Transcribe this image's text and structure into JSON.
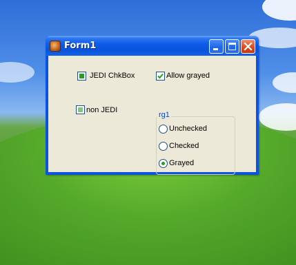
{
  "window": {
    "title": "Form1"
  },
  "controls": {
    "jedi_chkbox_label": "JEDI ChkBox",
    "allow_grayed_label": "Allow grayed",
    "non_jedi_label": "non JEDI",
    "allow_grayed_checked": true,
    "jedi_chkbox_state": "grayed",
    "non_jedi_state": "grayed"
  },
  "radio_group": {
    "caption": "rg1",
    "options": [
      "Unchecked",
      "Checked",
      "Grayed"
    ],
    "selected": "Grayed"
  },
  "colors": {
    "check_green": "#21a121",
    "titlebar_blue": "#0a53dc",
    "client_bg": "#ece9d8",
    "group_caption": "#0046d5"
  }
}
